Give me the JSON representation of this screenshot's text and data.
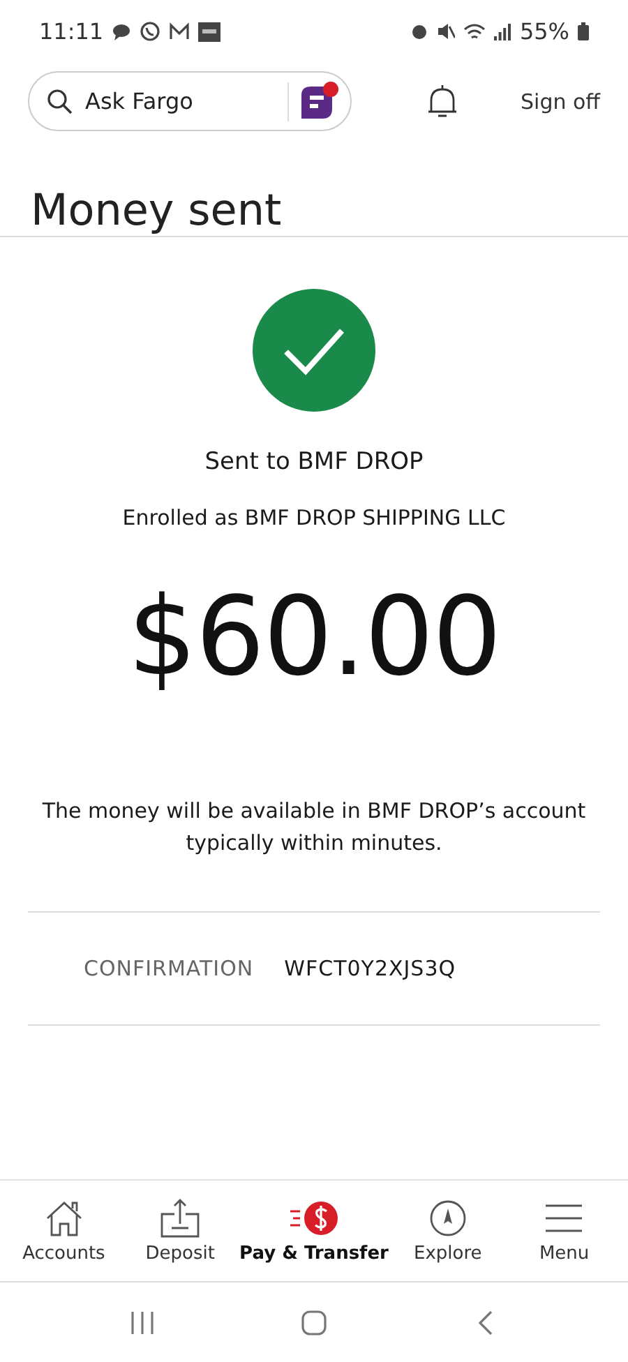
{
  "status_bar": {
    "time": "11:11",
    "battery": "55%"
  },
  "header": {
    "search": {
      "placeholder": "Ask Fargo"
    },
    "sign_off": "Sign off"
  },
  "title": "Money sent",
  "recipient": "Sent to BMF DROP",
  "enrolled": "Enrolled as BMF DROP SHIPPING LLC",
  "amount": "$60.00",
  "message": "The money will be available in BMF DROP’s account typically within minutes.",
  "confirmation": {
    "label": "CONFIRMATION",
    "value": "WFCT0Y2XJS3Q"
  },
  "tabs": [
    {
      "kind": "accounts",
      "label": "Accounts",
      "selected": false
    },
    {
      "kind": "deposit",
      "label": "Deposit",
      "selected": false
    },
    {
      "kind": "pay",
      "label": "Pay & Transfer",
      "selected": true
    },
    {
      "kind": "explore",
      "label": "Explore",
      "selected": false
    },
    {
      "kind": "menu",
      "label": "Menu",
      "selected": false
    }
  ]
}
